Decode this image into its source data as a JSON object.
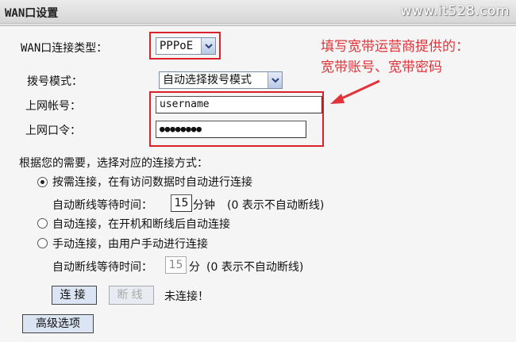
{
  "header": {
    "title": "WAN口设置",
    "watermark": "www.it528.com"
  },
  "form": {
    "connection_type_label": "WAN口连接类型：",
    "connection_type_value": "PPPoE",
    "dial_mode_label": "拨号模式：",
    "dial_mode_value": "自动选择拨号模式",
    "account_label": "上网帐号：",
    "account_value": "username",
    "password_label": "上网口令：",
    "password_value": "●●●●●●●●"
  },
  "annotation": {
    "line1": "填写宽带运营商提供的：",
    "line2": "宽带账号、宽带密码"
  },
  "connect_modes": {
    "heading": "根据您的需要，选择对应的连接方式：",
    "on_demand_label": "按需连接，在有访问数据时自动进行连接",
    "idle_time_label": "自动断线等待时间：",
    "idle_time_value": "15",
    "idle_unit_minutes": "分钟",
    "idle_hint": "(0 表示不自动断线)",
    "auto_label": "自动连接，在开机和断线后自动连接",
    "manual_label": "手动连接，由用户手动进行连接",
    "manual_idle_value": "15",
    "manual_idle_unit": "分",
    "manual_idle_hint": "(0 表示不自动断线)"
  },
  "actions": {
    "connect_label": "连接",
    "disconnect_label": "断线",
    "status_text": "未连接！",
    "advanced_label": "高级选项"
  },
  "colors": {
    "highlight": "#d9222a",
    "annotation": "#e0343a"
  }
}
